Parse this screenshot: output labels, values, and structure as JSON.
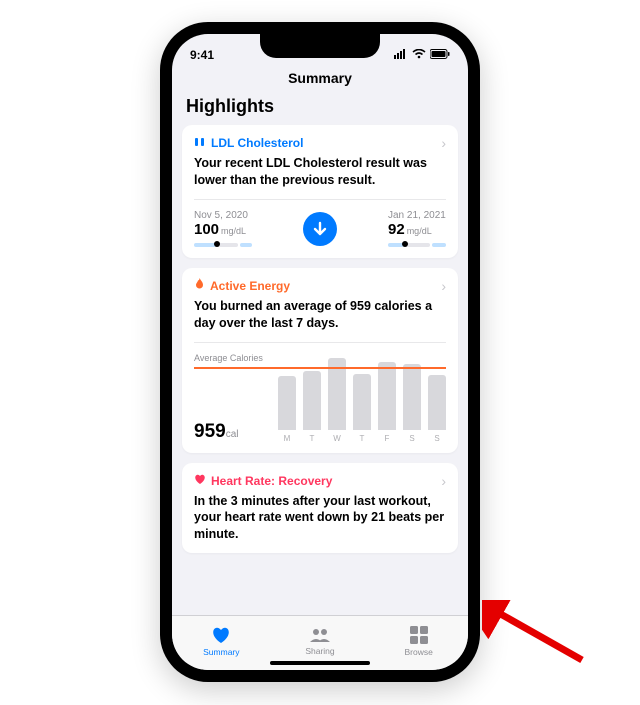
{
  "status": {
    "time": "9:41"
  },
  "nav": {
    "title": "Summary"
  },
  "section": {
    "title": "Highlights"
  },
  "ldl": {
    "title": "LDL Cholesterol",
    "body": "Your recent LDL Cholesterol result was lower than the previous result.",
    "left_date": "Nov 5, 2020",
    "left_val": "100",
    "left_unit": "mg/dL",
    "right_date": "Jan 21, 2021",
    "right_val": "92",
    "right_unit": "mg/dL"
  },
  "energy": {
    "title": "Active Energy",
    "body": "You burned an average of 959 calories a day over the last 7 days.",
    "avg_label": "Average Calories",
    "avg_value": "959",
    "avg_unit": "cal"
  },
  "heart": {
    "title": "Heart Rate: Recovery",
    "body": "In the 3 minutes after your last workout, your heart rate went down by 21 beats per minute."
  },
  "tabs": {
    "summary": "Summary",
    "sharing": "Sharing",
    "browse": "Browse"
  },
  "chart_data": {
    "type": "bar",
    "title": "Active Energy — Average Calories",
    "categories": [
      "M",
      "T",
      "W",
      "T",
      "F",
      "S",
      "S"
    ],
    "values": [
      800,
      880,
      1080,
      840,
      1020,
      980,
      820
    ],
    "average": 959,
    "ylim": [
      0,
      1200
    ],
    "ylabel": "cal",
    "average_line": true
  }
}
